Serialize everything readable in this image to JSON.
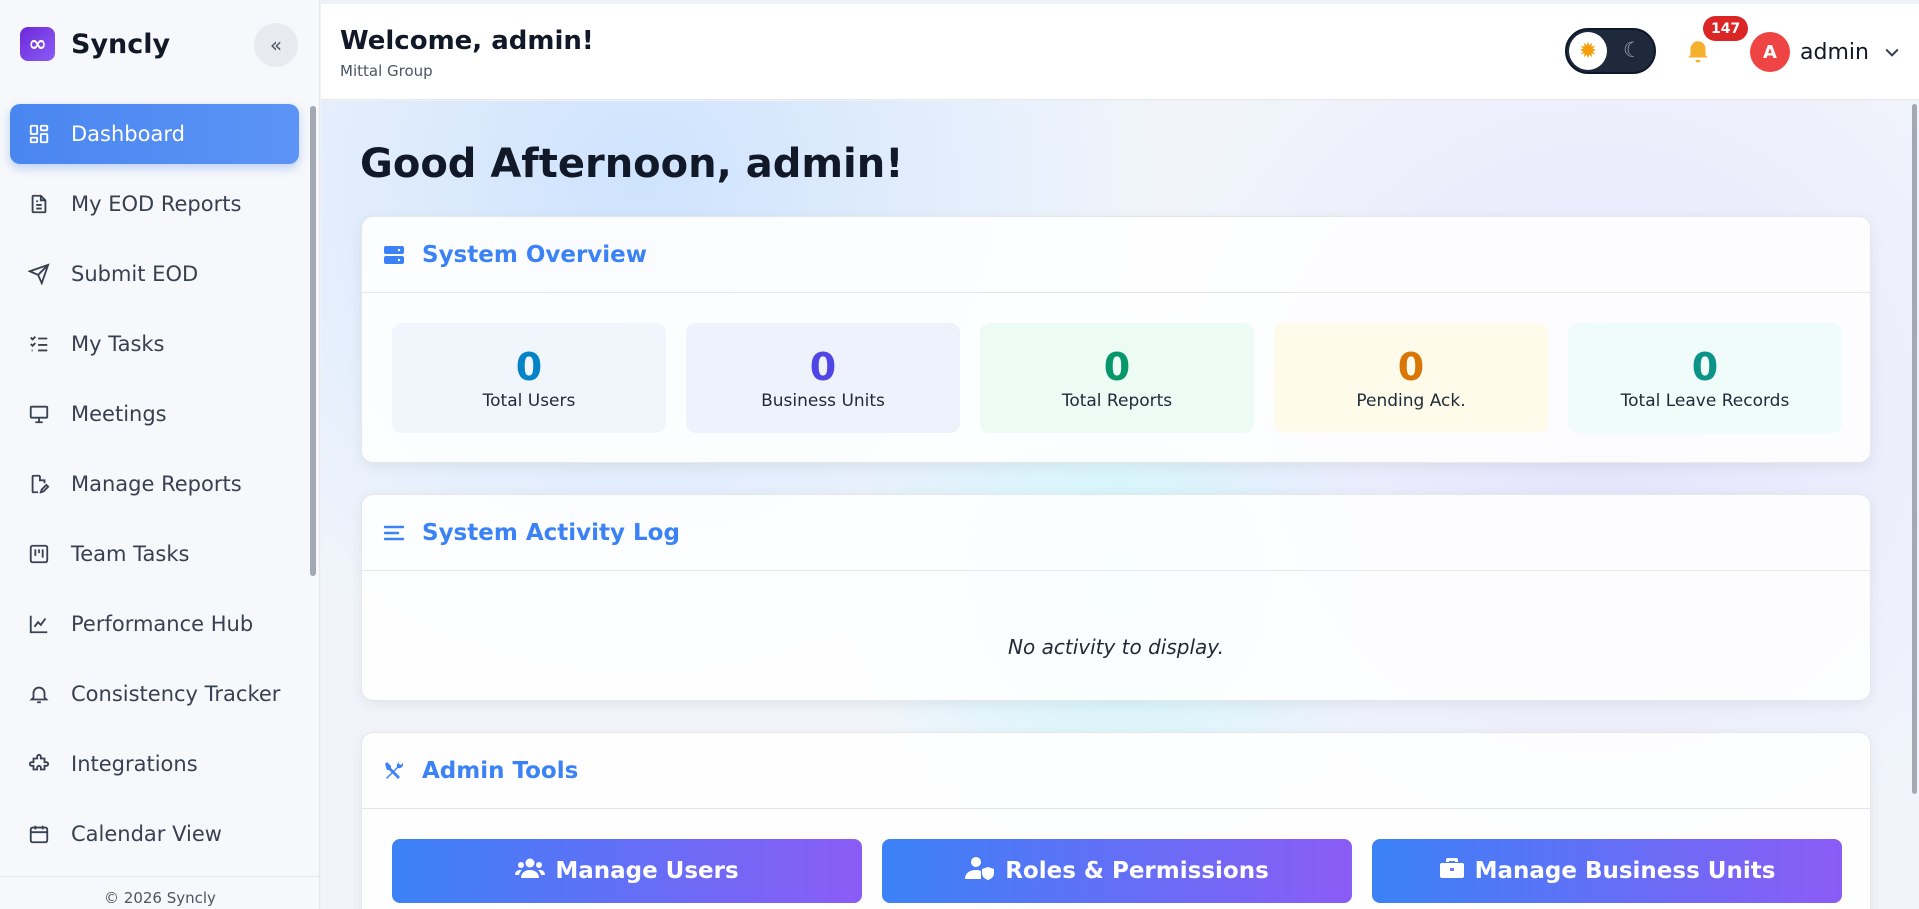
{
  "brand": {
    "name": "Syncly",
    "logo_glyph": "∞"
  },
  "sidebar": {
    "collapse_glyph": "«",
    "items": [
      {
        "label": "Dashboard",
        "icon": "grid-icon",
        "active": true
      },
      {
        "label": "My EOD Reports",
        "icon": "document-icon",
        "active": false
      },
      {
        "label": "Submit EOD",
        "icon": "send-icon",
        "active": false
      },
      {
        "label": "My Tasks",
        "icon": "checklist-icon",
        "active": false
      },
      {
        "label": "Meetings",
        "icon": "presentation-icon",
        "active": false
      },
      {
        "label": "Manage Reports",
        "icon": "edit-document-icon",
        "active": false
      },
      {
        "label": "Team Tasks",
        "icon": "kanban-icon",
        "active": false
      },
      {
        "label": "Performance Hub",
        "icon": "chart-line-icon",
        "active": false
      },
      {
        "label": "Consistency Tracker",
        "icon": "bell-icon",
        "active": false
      },
      {
        "label": "Integrations",
        "icon": "puzzle-icon",
        "active": false
      },
      {
        "label": "Calendar View",
        "icon": "calendar-icon",
        "active": false
      }
    ],
    "footer": "© 2026 Syncly"
  },
  "header": {
    "welcome": "Welcome, admin!",
    "organization": "Mittal Group",
    "notification_count": "147",
    "avatar_initial": "A",
    "user_name": "admin"
  },
  "main": {
    "greeting": "Good Afternoon, admin!",
    "overview": {
      "title": "System Overview",
      "stats": [
        {
          "value": "0",
          "label": "Total Users",
          "color": "#0284c7",
          "bg": "#f1f6fc"
        },
        {
          "value": "0",
          "label": "Business Units",
          "color": "#4f46e5",
          "bg": "#eef2fd"
        },
        {
          "value": "0",
          "label": "Total Reports",
          "color": "#059669",
          "bg": "#ecfbf4"
        },
        {
          "value": "0",
          "label": "Pending Ack.",
          "color": "#d97706",
          "bg": "#fefbeb"
        },
        {
          "value": "0",
          "label": "Total Leave Records",
          "color": "#0d9488",
          "bg": "#f0fcfa"
        }
      ]
    },
    "activity": {
      "title": "System Activity Log",
      "empty": "No activity to display."
    },
    "admin_tools": {
      "title": "Admin Tools",
      "buttons": [
        {
          "label": "Manage Users",
          "icon": "users-icon"
        },
        {
          "label": "Roles & Permissions",
          "icon": "user-shield-icon"
        },
        {
          "label": "Manage Business Units",
          "icon": "briefcase-icon"
        }
      ]
    }
  },
  "colors": {
    "accent": "#3b82f6",
    "active_nav": "#4a86f0",
    "badge": "#dc2626",
    "avatar": "#ef4444"
  }
}
